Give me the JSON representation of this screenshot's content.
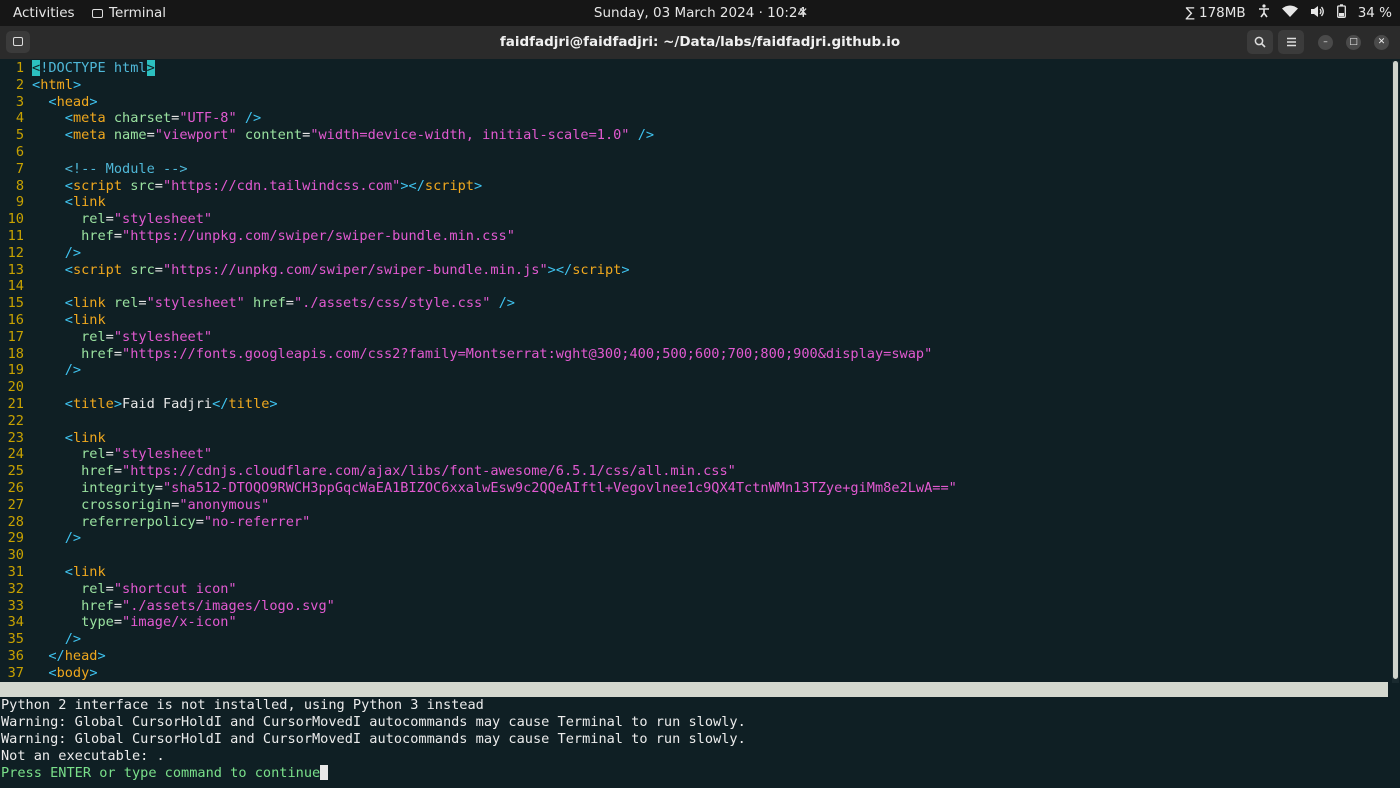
{
  "topbar": {
    "activities": "Activities",
    "app_label": "Terminal",
    "datetime": "Sunday, 03 March 2024 · 10:24",
    "memory": "∑ 178MB",
    "battery": "34 %",
    "icons": [
      "terminal-icon",
      "notifications-off-icon",
      "accessibility-icon",
      "wifi-icon",
      "volume-icon",
      "battery-icon"
    ]
  },
  "window": {
    "title": "faidfadjri@faidfadjri: ~/Data/labs/faidfadjri.github.io",
    "buttons": [
      "new-tab",
      "search",
      "menu",
      "minimize",
      "maximize",
      "close"
    ]
  },
  "editor": {
    "lines": [
      {
        "n": "1",
        "tokens": [
          [
            "cur",
            "<"
          ],
          [
            "c",
            "!DOCTYPE html"
          ],
          [
            "cur",
            ">"
          ]
        ]
      },
      {
        "n": "2",
        "tokens": [
          [
            "p",
            "<"
          ],
          [
            "t",
            "html"
          ],
          [
            "p",
            ">"
          ]
        ]
      },
      {
        "n": "3",
        "tokens": [
          [
            "x",
            "  "
          ],
          [
            "p",
            "<"
          ],
          [
            "t",
            "head"
          ],
          [
            "p",
            ">"
          ]
        ]
      },
      {
        "n": "4",
        "tokens": [
          [
            "x",
            "    "
          ],
          [
            "p",
            "<"
          ],
          [
            "t",
            "meta "
          ],
          [
            "a",
            "charset"
          ],
          [
            "x",
            "="
          ],
          [
            "s",
            "\"UTF-8\""
          ],
          [
            "x",
            " "
          ],
          [
            "p",
            "/>"
          ]
        ]
      },
      {
        "n": "5",
        "tokens": [
          [
            "x",
            "    "
          ],
          [
            "p",
            "<"
          ],
          [
            "t",
            "meta "
          ],
          [
            "a",
            "name"
          ],
          [
            "x",
            "="
          ],
          [
            "s",
            "\"viewport\""
          ],
          [
            "x",
            " "
          ],
          [
            "a",
            "content"
          ],
          [
            "x",
            "="
          ],
          [
            "s",
            "\"width=device-width, initial-scale=1.0\""
          ],
          [
            "x",
            " "
          ],
          [
            "p",
            "/>"
          ]
        ]
      },
      {
        "n": "6",
        "tokens": []
      },
      {
        "n": "7",
        "tokens": [
          [
            "x",
            "    "
          ],
          [
            "c",
            "<!-- Module -->"
          ]
        ]
      },
      {
        "n": "8",
        "tokens": [
          [
            "x",
            "    "
          ],
          [
            "p",
            "<"
          ],
          [
            "t",
            "script "
          ],
          [
            "a",
            "src"
          ],
          [
            "x",
            "="
          ],
          [
            "s",
            "\"https://cdn.tailwindcss.com\""
          ],
          [
            "p",
            "></"
          ],
          [
            "t",
            "script"
          ],
          [
            "p",
            ">"
          ]
        ]
      },
      {
        "n": "9",
        "tokens": [
          [
            "x",
            "    "
          ],
          [
            "p",
            "<"
          ],
          [
            "t",
            "link"
          ]
        ]
      },
      {
        "n": "10",
        "tokens": [
          [
            "x",
            "      "
          ],
          [
            "a",
            "rel"
          ],
          [
            "x",
            "="
          ],
          [
            "s",
            "\"stylesheet\""
          ]
        ]
      },
      {
        "n": "11",
        "tokens": [
          [
            "x",
            "      "
          ],
          [
            "a",
            "href"
          ],
          [
            "x",
            "="
          ],
          [
            "s",
            "\"https://unpkg.com/swiper/swiper-bundle.min.css\""
          ]
        ]
      },
      {
        "n": "12",
        "tokens": [
          [
            "x",
            "    "
          ],
          [
            "p",
            "/>"
          ]
        ]
      },
      {
        "n": "13",
        "tokens": [
          [
            "x",
            "    "
          ],
          [
            "p",
            "<"
          ],
          [
            "t",
            "script "
          ],
          [
            "a",
            "src"
          ],
          [
            "x",
            "="
          ],
          [
            "s",
            "\"https://unpkg.com/swiper/swiper-bundle.min.js\""
          ],
          [
            "p",
            "></"
          ],
          [
            "t",
            "script"
          ],
          [
            "p",
            ">"
          ]
        ]
      },
      {
        "n": "14",
        "tokens": []
      },
      {
        "n": "15",
        "tokens": [
          [
            "x",
            "    "
          ],
          [
            "p",
            "<"
          ],
          [
            "t",
            "link "
          ],
          [
            "a",
            "rel"
          ],
          [
            "x",
            "="
          ],
          [
            "s",
            "\"stylesheet\""
          ],
          [
            "x",
            " "
          ],
          [
            "a",
            "href"
          ],
          [
            "x",
            "="
          ],
          [
            "s",
            "\"./assets/css/style.css\""
          ],
          [
            "x",
            " "
          ],
          [
            "p",
            "/>"
          ]
        ]
      },
      {
        "n": "16",
        "tokens": [
          [
            "x",
            "    "
          ],
          [
            "p",
            "<"
          ],
          [
            "t",
            "link"
          ]
        ]
      },
      {
        "n": "17",
        "tokens": [
          [
            "x",
            "      "
          ],
          [
            "a",
            "rel"
          ],
          [
            "x",
            "="
          ],
          [
            "s",
            "\"stylesheet\""
          ]
        ]
      },
      {
        "n": "18",
        "tokens": [
          [
            "x",
            "      "
          ],
          [
            "a",
            "href"
          ],
          [
            "x",
            "="
          ],
          [
            "s",
            "\"https://fonts.googleapis.com/css2?family=Montserrat:wght@300;400;500;600;700;800;900&display=swap\""
          ]
        ]
      },
      {
        "n": "19",
        "tokens": [
          [
            "x",
            "    "
          ],
          [
            "p",
            "/>"
          ]
        ]
      },
      {
        "n": "20",
        "tokens": []
      },
      {
        "n": "21",
        "tokens": [
          [
            "x",
            "    "
          ],
          [
            "p",
            "<"
          ],
          [
            "t",
            "title"
          ],
          [
            "p",
            ">"
          ],
          [
            "x",
            "Faid Fadjri"
          ],
          [
            "p",
            "</"
          ],
          [
            "t",
            "title"
          ],
          [
            "p",
            ">"
          ]
        ]
      },
      {
        "n": "22",
        "tokens": []
      },
      {
        "n": "23",
        "tokens": [
          [
            "x",
            "    "
          ],
          [
            "p",
            "<"
          ],
          [
            "t",
            "link"
          ]
        ]
      },
      {
        "n": "24",
        "tokens": [
          [
            "x",
            "      "
          ],
          [
            "a",
            "rel"
          ],
          [
            "x",
            "="
          ],
          [
            "s",
            "\"stylesheet\""
          ]
        ]
      },
      {
        "n": "25",
        "tokens": [
          [
            "x",
            "      "
          ],
          [
            "a",
            "href"
          ],
          [
            "x",
            "="
          ],
          [
            "s",
            "\"https://cdnjs.cloudflare.com/ajax/libs/font-awesome/6.5.1/css/all.min.css\""
          ]
        ]
      },
      {
        "n": "26",
        "tokens": [
          [
            "x",
            "      "
          ],
          [
            "a",
            "integrity"
          ],
          [
            "x",
            "="
          ],
          [
            "s",
            "\"sha512-DTOQO9RWCH3ppGqcWaEA1BIZOC6xxalwEsw9c2QQeAIftl+Vegovlnee1c9QX4TctnWMn13TZye+giMm8e2LwA==\""
          ]
        ]
      },
      {
        "n": "27",
        "tokens": [
          [
            "x",
            "      "
          ],
          [
            "a",
            "crossorigin"
          ],
          [
            "x",
            "="
          ],
          [
            "s",
            "\"anonymous\""
          ]
        ]
      },
      {
        "n": "28",
        "tokens": [
          [
            "x",
            "      "
          ],
          [
            "a",
            "referrerpolicy"
          ],
          [
            "x",
            "="
          ],
          [
            "s",
            "\"no-referrer\""
          ]
        ]
      },
      {
        "n": "29",
        "tokens": [
          [
            "x",
            "    "
          ],
          [
            "p",
            "/>"
          ]
        ]
      },
      {
        "n": "30",
        "tokens": []
      },
      {
        "n": "31",
        "tokens": [
          [
            "x",
            "    "
          ],
          [
            "p",
            "<"
          ],
          [
            "t",
            "link"
          ]
        ]
      },
      {
        "n": "32",
        "tokens": [
          [
            "x",
            "      "
          ],
          [
            "a",
            "rel"
          ],
          [
            "x",
            "="
          ],
          [
            "s",
            "\"shortcut icon\""
          ]
        ]
      },
      {
        "n": "33",
        "tokens": [
          [
            "x",
            "      "
          ],
          [
            "a",
            "href"
          ],
          [
            "x",
            "="
          ],
          [
            "s",
            "\"./assets/images/logo.svg\""
          ]
        ]
      },
      {
        "n": "34",
        "tokens": [
          [
            "x",
            "      "
          ],
          [
            "a",
            "type"
          ],
          [
            "x",
            "="
          ],
          [
            "s",
            "\"image/x-icon\""
          ]
        ]
      },
      {
        "n": "35",
        "tokens": [
          [
            "x",
            "    "
          ],
          [
            "p",
            "/>"
          ]
        ]
      },
      {
        "n": "36",
        "tokens": [
          [
            "x",
            "  "
          ],
          [
            "p",
            "</"
          ],
          [
            "t",
            "head"
          ],
          [
            "p",
            ">"
          ]
        ]
      },
      {
        "n": "37",
        "tokens": [
          [
            "x",
            "  "
          ],
          [
            "p",
            "<"
          ],
          [
            "t",
            "body"
          ],
          [
            "p",
            ">"
          ]
        ]
      }
    ]
  },
  "messages": [
    "Python 2 interface is not installed, using Python 3 instead",
    "Warning: Global CursorHoldI and CursorMovedI autocommands may cause Terminal to run slowly.",
    "Warning: Global CursorHoldI and CursorMovedI autocommands may cause Terminal to run slowly.",
    "Not an executable: ."
  ],
  "prompt": "Press ENTER or type command to continue",
  "colors": {
    "background": "#0f1f24",
    "tag": "#f0a81e",
    "attribute": "#9ae2a0",
    "string": "#e25ad1",
    "punctuation": "#3fc3ef",
    "line_number": "#c8a200",
    "prompt": "#7ae08a"
  }
}
